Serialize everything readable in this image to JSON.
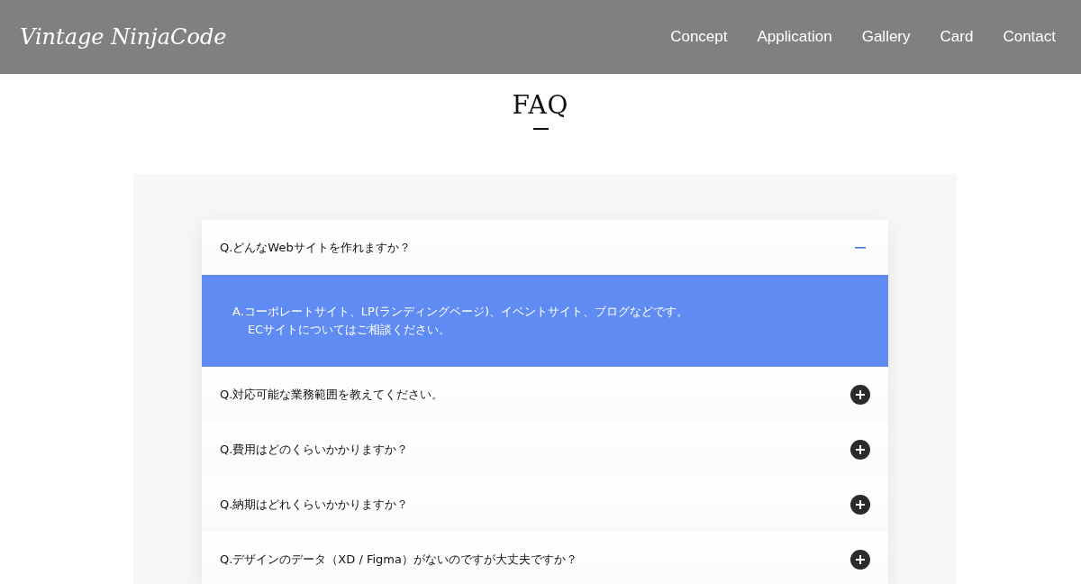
{
  "header": {
    "logo": "Vintage NinjaCode",
    "nav": [
      "Concept",
      "Application",
      "Gallery",
      "Card",
      "Contact"
    ]
  },
  "section": {
    "title": "FAQ"
  },
  "faq": [
    {
      "question": "Q.どんなWebサイトを作れますか？",
      "expanded": true,
      "answer": "A.コーポレートサイト、LP(ランディングページ)、イベントサイト、ブログなどです。\nECサイトについてはご相談ください。"
    },
    {
      "question": "Q.対応可能な業務範囲を教えてください。",
      "expanded": false
    },
    {
      "question": "Q.費用はどのくらいかかりますか？",
      "expanded": false
    },
    {
      "question": "Q.納期はどれくらいかかりますか？",
      "expanded": false
    },
    {
      "question": "Q.デザインのデータ（XD / Figma）がないのですが大丈夫ですか？",
      "expanded": false
    }
  ]
}
